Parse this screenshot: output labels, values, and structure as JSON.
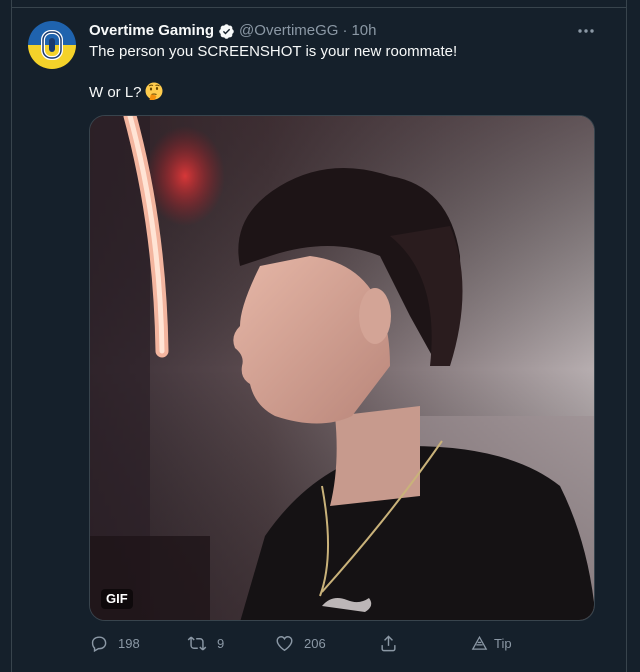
{
  "tweet": {
    "display_name": "Overtime Gaming",
    "handle": "@OvertimeGG",
    "separator": "·",
    "time": "10h",
    "text_line1": "The person you SCREENSHOT is your new roommate!",
    "text_line2": "W or L?",
    "media": {
      "badge": "GIF"
    },
    "actions": {
      "reply_count": "198",
      "retweet_count": "9",
      "like_count": "206",
      "tip_label": "Tip"
    }
  },
  "colors": {
    "background": "#15202b",
    "border": "#38444d",
    "primary_text": "#f7f9f9",
    "secondary_text": "#8b98a5",
    "avatar_yellow": "#f4d22a",
    "avatar_blue": "#1f63ae"
  },
  "icons": {
    "verified": "verified-badge-icon",
    "more": "more-dots-icon",
    "emoji": "thinking-face-emoji",
    "reply": "reply-icon",
    "retweet": "retweet-icon",
    "like": "heart-icon",
    "share": "share-icon",
    "tip": "tip-icon"
  }
}
